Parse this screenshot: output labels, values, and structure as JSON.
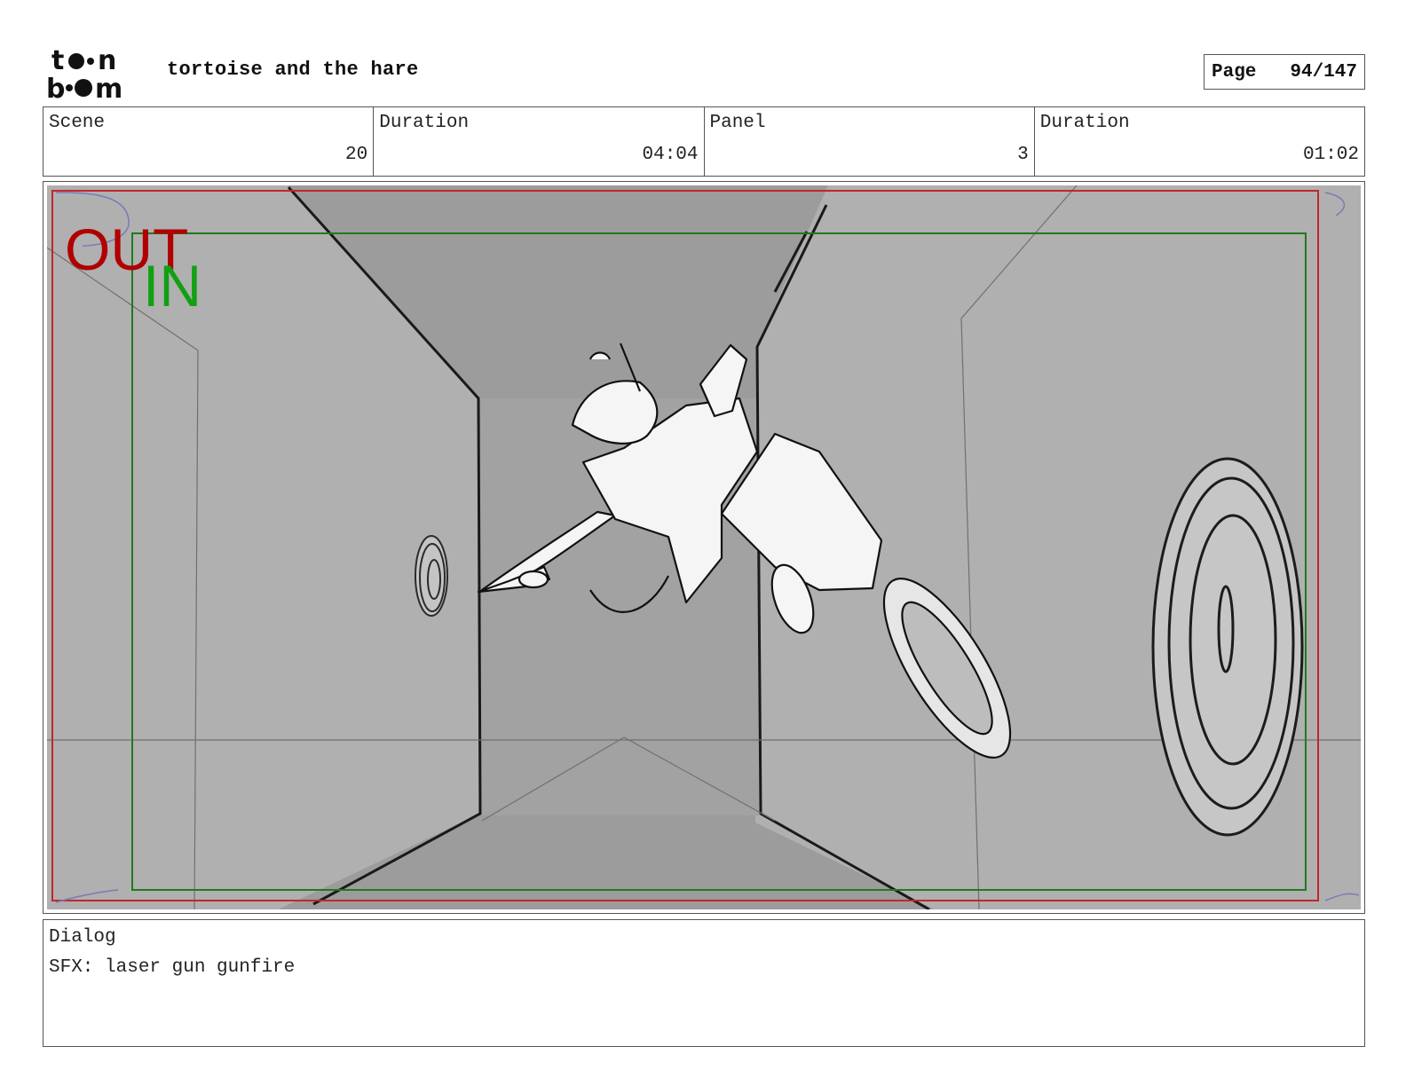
{
  "header": {
    "logo_text": "toon boom",
    "project_title": "tortoise and the hare",
    "page_label": "Page",
    "page_value": "94/147"
  },
  "info": {
    "scene_label": "Scene",
    "scene_value": "20",
    "scene_duration_label": "Duration",
    "scene_duration_value": "04:04",
    "panel_label": "Panel",
    "panel_value": "3",
    "panel_duration_label": "Duration",
    "panel_duration_value": "01:02"
  },
  "frame_marks": {
    "out_label": "OUT",
    "in_label": "IN",
    "out_color": "#b00000",
    "in_color": "#12a012"
  },
  "dialog": {
    "label": "Dialog",
    "text": "SFX: laser gun gunfire"
  }
}
